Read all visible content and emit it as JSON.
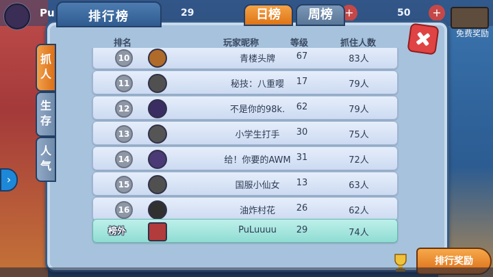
{
  "topbar": {
    "player_name": "Pu",
    "level": "29",
    "points": "50",
    "reward_label": "免费奖励"
  },
  "panel": {
    "title": "排行榜",
    "period_tabs": [
      {
        "label": "日榜"
      },
      {
        "label": "周榜"
      }
    ],
    "side_tabs": [
      {
        "label": "抓人",
        "chars": [
          "抓",
          "人"
        ]
      },
      {
        "label": "生存",
        "chars": [
          "生",
          "存"
        ]
      },
      {
        "label": "人气",
        "chars": [
          "人",
          "气"
        ]
      }
    ],
    "columns": {
      "rank": "排名",
      "name": "玩家昵称",
      "level": "等级",
      "catch": "抓住人数"
    },
    "rows": [
      {
        "rank": "10",
        "name": "青楼头牌",
        "level": "67",
        "catch": "83人",
        "icon": "medal-icon",
        "color": "#b06a2a"
      },
      {
        "rank": "11",
        "name": "秘技：八重嘤",
        "level": "17",
        "catch": "79人",
        "icon": "bird-icon",
        "color": "#505050"
      },
      {
        "rank": "12",
        "name": "不是你的98k.",
        "level": "62",
        "catch": "79人",
        "icon": "gun-icon",
        "color": "#3a2d62"
      },
      {
        "rank": "13",
        "name": "小学生打手",
        "level": "30",
        "catch": "75人",
        "icon": "gem-icon",
        "color": "#555555"
      },
      {
        "rank": "14",
        "name": "给！你要的AWM",
        "level": "31",
        "catch": "72人",
        "icon": "box-icon",
        "color": "#4a3a76"
      },
      {
        "rank": "15",
        "name": "国服小仙女",
        "level": "13",
        "catch": "63人",
        "icon": "bird-icon",
        "color": "#505050"
      },
      {
        "rank": "16",
        "name": "油炸村花",
        "level": "26",
        "catch": "62人",
        "icon": "ball-icon",
        "color": "#303030"
      }
    ],
    "self_row": {
      "rank_label": "榜外",
      "name": "PuLuuuu",
      "level": "29",
      "catch": "74人",
      "icon": "chest-icon",
      "color": "#b23b3b"
    }
  },
  "footer": {
    "rank_reward_label": "排行奖励"
  }
}
